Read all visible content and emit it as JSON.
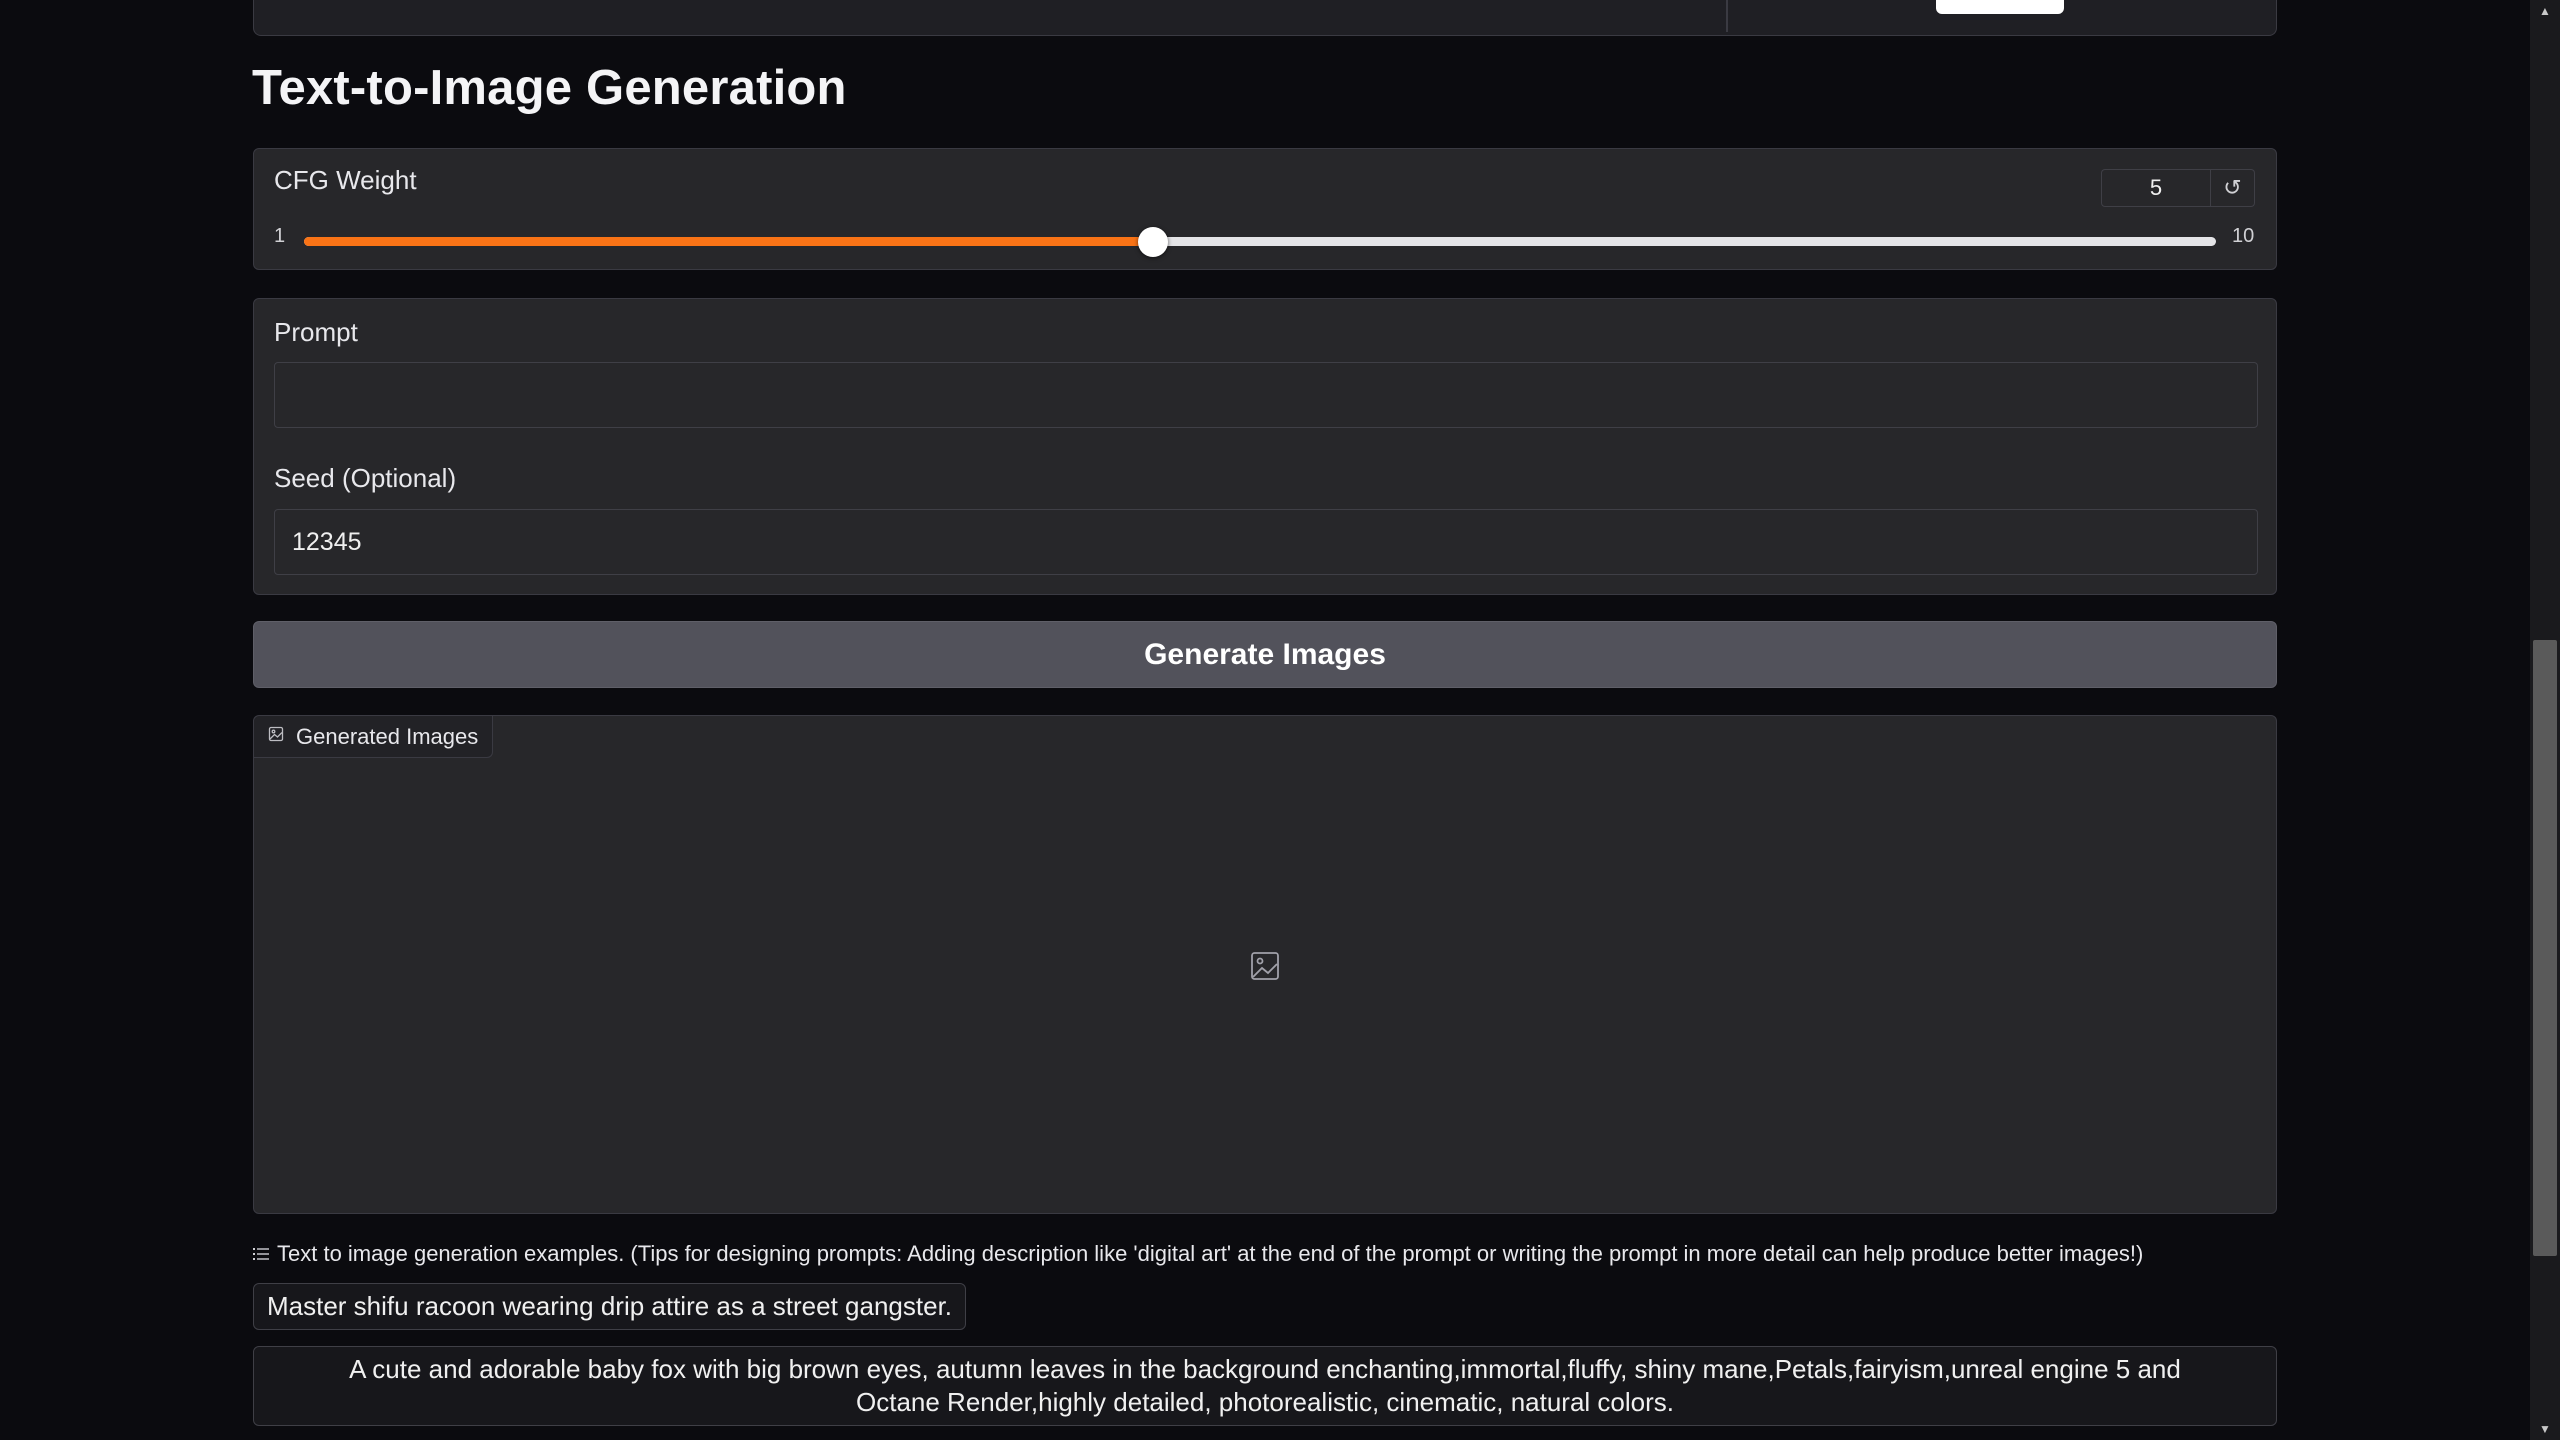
{
  "heading": "Text-to-Image Generation",
  "cfg": {
    "label": "CFG Weight",
    "value": "5",
    "min": "1",
    "max": "10",
    "fraction": 0.444,
    "reset_icon": "↺"
  },
  "prompt": {
    "label": "Prompt",
    "value": ""
  },
  "seed": {
    "label": "Seed (Optional)",
    "value": "12345"
  },
  "generate_button": "Generate Images",
  "gallery": {
    "tab_label": "Generated Images",
    "icon": "image-icon"
  },
  "examples": {
    "header": "Text to image generation examples. (Tips for designing prompts: Adding description like 'digital art' at the end of the prompt or writing the prompt in more detail can help produce better images!)",
    "items": [
      "Master shifu racoon wearing drip attire as a street gangster.",
      "A cute and adorable baby fox with big brown eyes, autumn leaves in the background enchanting,immortal,fluffy, shiny mane,Petals,fairyism,unreal engine 5 and Octane Render,highly detailed, photorealistic, cinematic, natural colors."
    ]
  },
  "colors": {
    "accent": "#f97316",
    "background": "#0b0b0f",
    "panel": "#27272a",
    "button": "#52525b"
  }
}
